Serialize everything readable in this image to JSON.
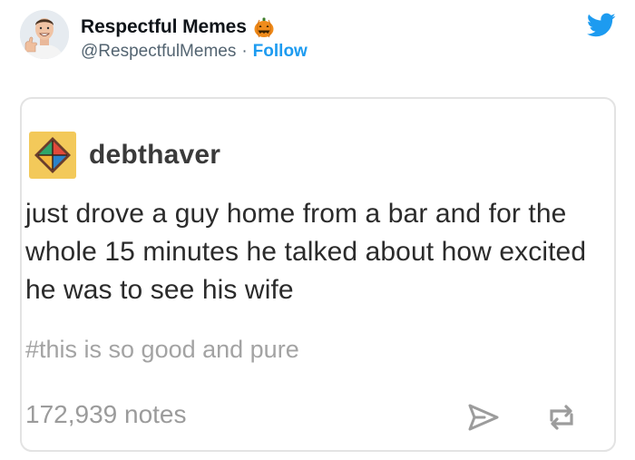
{
  "tweet": {
    "author_name": "Respectful Memes",
    "author_handle": "@RespectfulMemes",
    "separator": "·",
    "follow_label": "Follow",
    "brand_color": "#1d9bf0",
    "name_emoji": "jack-o-lantern-icon",
    "logo_icon": "twitter-bird-icon"
  },
  "post": {
    "blog_name": "debthaver",
    "body": "just drove a guy home from a bar and for the whole 15 minutes he talked about how excited he was to see his wife",
    "tags": "#this is so good and pure",
    "notes": "172,939 notes",
    "actions": [
      "share-icon",
      "reblog-icon"
    ]
  }
}
